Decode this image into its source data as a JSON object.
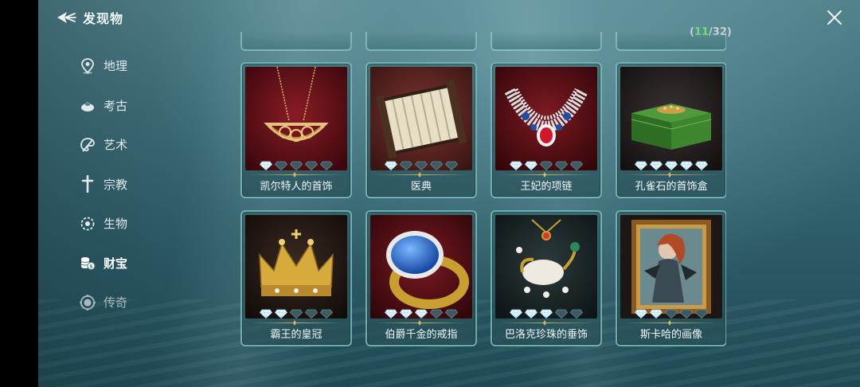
{
  "header": {
    "title": "发现物",
    "back_icon": "back-arrow-icon",
    "close_icon": "close-icon"
  },
  "counter": {
    "collected": "11",
    "total": "/32)",
    "open": "("
  },
  "sidebar": {
    "items": [
      {
        "label": "地理",
        "icon": "location-pin-icon",
        "active": false
      },
      {
        "label": "考古",
        "icon": "artifact-icon",
        "active": false
      },
      {
        "label": "艺术",
        "icon": "palette-icon",
        "active": false
      },
      {
        "label": "宗教",
        "icon": "cross-icon",
        "active": false
      },
      {
        "label": "生物",
        "icon": "creature-icon",
        "active": false
      },
      {
        "label": "财宝",
        "icon": "coins-icon",
        "active": true
      },
      {
        "label": "传奇",
        "icon": "legend-icon",
        "active": false
      }
    ]
  },
  "cards": [
    {
      "name": "凯尔特人的首饰",
      "icon": "celtic-necklace-icon",
      "filled_diamonds": 1,
      "total_diamonds": 5
    },
    {
      "name": "医典",
      "icon": "medical-book-icon",
      "filled_diamonds": 1,
      "total_diamonds": 5
    },
    {
      "name": "王妃的项链",
      "icon": "jeweled-necklace-icon",
      "filled_diamonds": 2,
      "total_diamonds": 5
    },
    {
      "name": "孔雀石的首饰盒",
      "icon": "malachite-box-icon",
      "filled_diamonds": 5,
      "total_diamonds": 5
    },
    {
      "name": "霸王的皇冠",
      "icon": "crown-icon",
      "filled_diamonds": 2,
      "total_diamonds": 5
    },
    {
      "name": "伯爵千金的戒指",
      "icon": "sapphire-ring-icon",
      "filled_diamonds": 3,
      "total_diamonds": 5
    },
    {
      "name": "巴洛克珍珠的垂饰",
      "icon": "baroque-pearl-pendant-icon",
      "filled_diamonds": 3,
      "total_diamonds": 5
    },
    {
      "name": "斯卡哈的画像",
      "icon": "portrait-painting-icon",
      "filled_diamonds": 2,
      "total_diamonds": 5
    }
  ],
  "colors": {
    "accent_green": "#6fe07a",
    "card_border": "#8cd2d2",
    "gold": "#d8b868"
  }
}
